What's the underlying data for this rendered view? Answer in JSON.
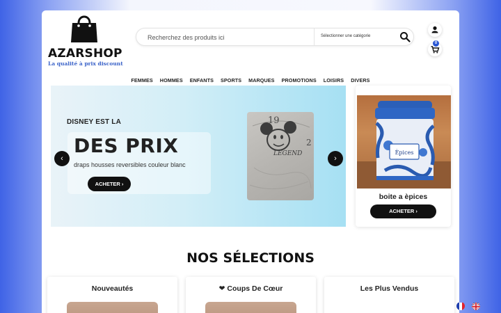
{
  "header": {
    "brand": "AZARSHOP",
    "tagline": "La qualité à prix discount",
    "search_placeholder": "Recherchez des produits ici",
    "category_select": "Sélectionner une catégorie",
    "cart_count": "0",
    "icons": [
      "shopping-bag-icon",
      "search-icon",
      "user-icon",
      "cart-icon"
    ]
  },
  "nav": {
    "items": [
      "FEMMES",
      "HOMMES",
      "ENFANTS",
      "SPORTS",
      "MARQUES",
      "PROMOTIONS",
      "LOISIRS",
      "DIVERS"
    ]
  },
  "hero": {
    "kicker": "DISNEY EST LA",
    "title": "DES PRIX",
    "subtitle": "draps housses reversibles couleur blanc",
    "cta": "ACHETER ›",
    "prev": "‹",
    "next": "›"
  },
  "promo": {
    "name": "boite a èpices",
    "cta": "ACHETER ›",
    "label_on_tin": "Èpices"
  },
  "selections": {
    "title": "NOS SÉLECTIONS",
    "columns": [
      {
        "icon": "",
        "label": "Nouveautés"
      },
      {
        "icon": "❤",
        "label": "Coups De Cœur"
      },
      {
        "icon": "",
        "label": "Les Plus Vendus"
      }
    ]
  },
  "languages": [
    "fr-flag-icon",
    "en-flag-icon"
  ],
  "colors": {
    "accent": "#2956d3",
    "button": "#111111",
    "hero_bg": "#b9e6f5"
  }
}
